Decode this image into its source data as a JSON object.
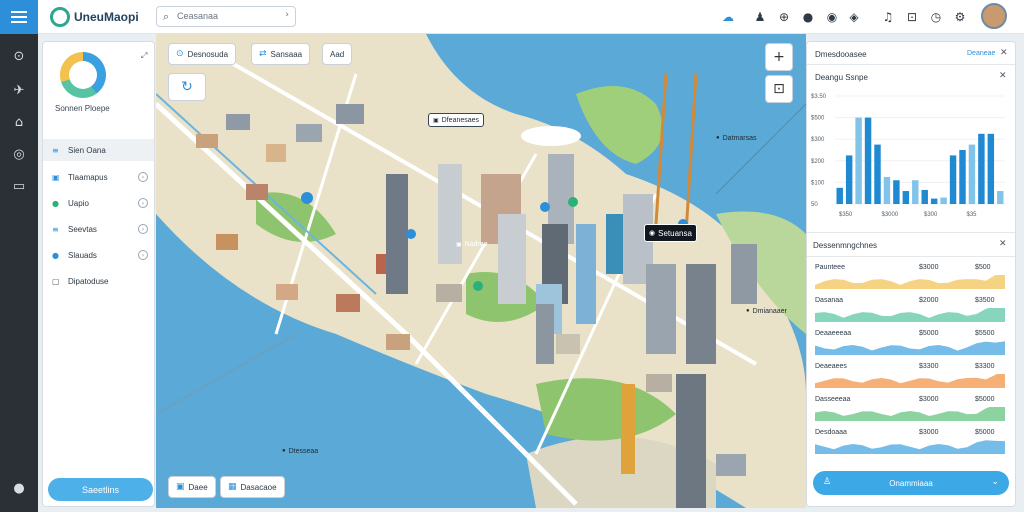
{
  "app": {
    "name": "UneuMaopi",
    "avatar_alt": "user-avatar"
  },
  "topbar": {
    "search_value": "Ceasanaa"
  },
  "left_panel": {
    "title": "Sonnen Ploepe",
    "items": [
      {
        "label": "Sien Oana",
        "icon": "list-icon"
      },
      {
        "label": "Tlaamapus",
        "icon": "layers-icon"
      },
      {
        "label": "Uapio",
        "icon": "pin-icon"
      },
      {
        "label": "Seevtas",
        "icon": "settings-icon"
      },
      {
        "label": "Slauads",
        "icon": "cloud-icon"
      },
      {
        "label": "Dipatoduse",
        "icon": "doc-icon"
      }
    ],
    "button_label": "Saeetlins"
  },
  "map": {
    "chips": [
      "Desnosuda",
      "Sansaaa",
      "Aad"
    ],
    "labels": [
      "Dfeanesaes",
      "Datmarsas",
      "Nadree",
      "Setuansa",
      "Dmianaaer",
      "Dtesseaa"
    ],
    "bottom_chips": [
      "Daee",
      "Dasacaoe"
    ]
  },
  "right_panel": {
    "header": "Dmesdooasee",
    "header_link": "Deaneae",
    "chart_title": "Deangu Ssnpe",
    "section2_title": "Dessenmngchnes",
    "button_label": "Onammiaaa",
    "rows": [
      {
        "label": "Paunteee",
        "value": "$3000",
        "value2": "$500"
      },
      {
        "label": "Dasanaa",
        "value": "$2000",
        "value2": "$3500"
      },
      {
        "label": "Deaaeeeaa",
        "value": "$5000",
        "value2": "$5500"
      },
      {
        "label": "Deaeaees",
        "value": "$3300",
        "value2": "$3300"
      },
      {
        "label": "Dasseeeaa",
        "value": "$3000",
        "value2": "$5000"
      },
      {
        "label": "Desdoaaa",
        "value": "$3000",
        "value2": "$5000"
      }
    ]
  },
  "chart_data": {
    "type": "bar",
    "title": "Deangu Ssnpe",
    "ytick_labels": [
      "$3.50",
      "$500",
      "$300",
      "$200",
      "$100",
      "50"
    ],
    "xtick_labels": [
      "$350",
      "$3000",
      "$300",
      "$35"
    ],
    "values": [
      15,
      45,
      80,
      80,
      55,
      25,
      22,
      12,
      22,
      13,
      5,
      6,
      45,
      50,
      55,
      65,
      65,
      12
    ],
    "colors": [
      "#1f8ad2",
      "#82c3ea"
    ]
  }
}
